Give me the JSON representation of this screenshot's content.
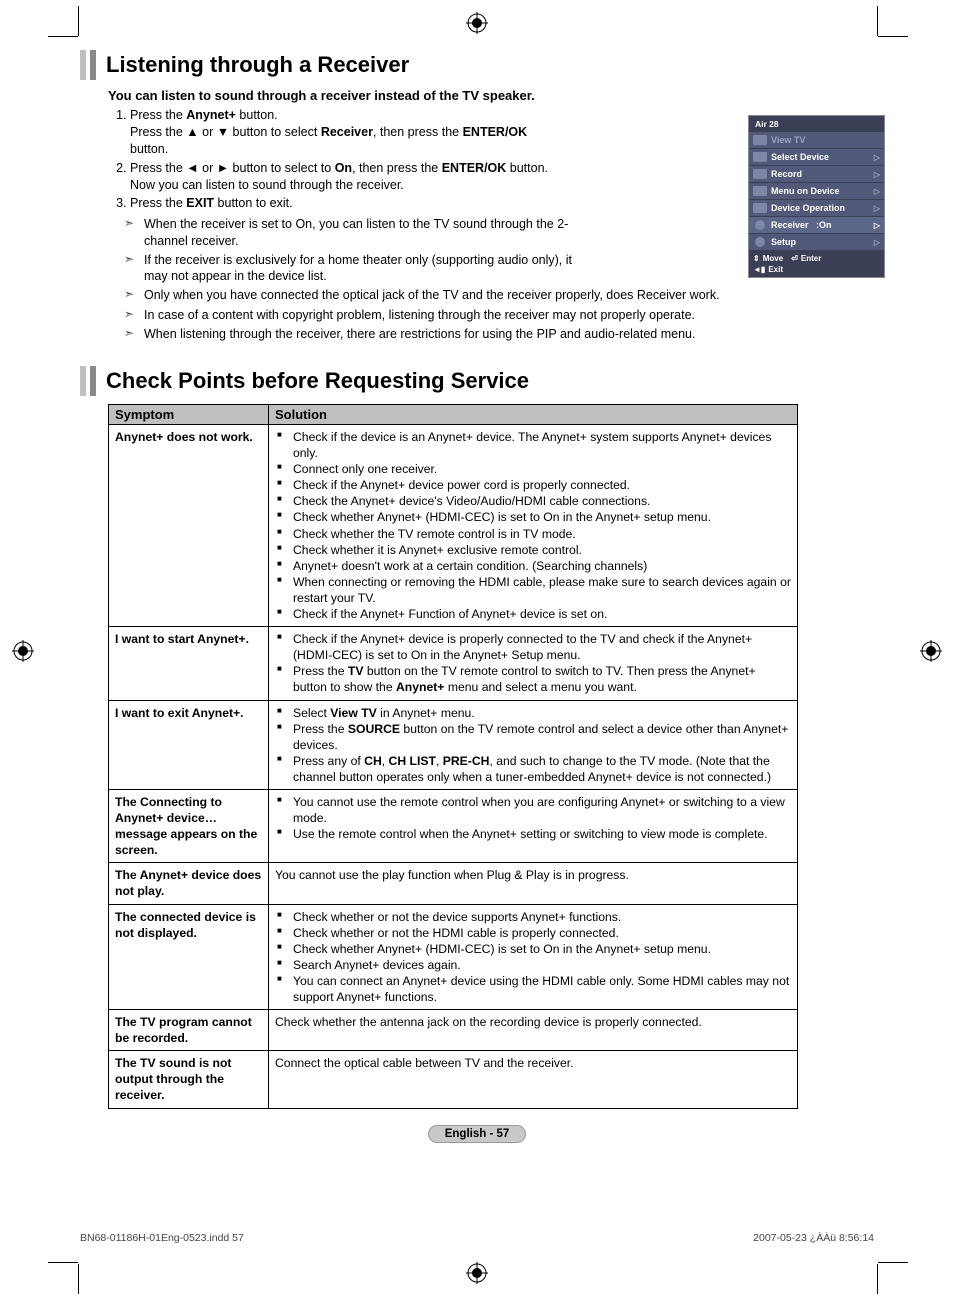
{
  "section1": {
    "title": "Listening through a Receiver",
    "subhead": "You can listen to sound through a receiver instead of the TV speaker.",
    "steps": [
      {
        "num": "1.",
        "html": "Press the <strong>Anynet+</strong> button.<br>Press the ▲ or ▼ button to select <strong>Receiver</strong>, then press the <strong>ENTER/OK</strong> button."
      },
      {
        "num": "2.",
        "html": "Press the ◄ or ► button to select to <strong>On</strong>, then press the <strong>ENTER/OK</strong> button.<br>Now you can listen to sound through the receiver."
      },
      {
        "num": "3.",
        "html": "Press the <strong>EXIT</strong> button to exit."
      }
    ],
    "notes": [
      "When the receiver is set to On, you can listen to the TV sound through the 2-channel receiver.",
      "If the receiver is exclusively for a home theater only (supporting audio only), it may not appear in the device list.",
      "Only when you have connected the optical jack of the TV and the receiver properly, does Receiver work.",
      "In case of a content with copyright problem, listening through the receiver may not properly operate.",
      "When listening through the receiver, there are restrictions for using the PIP and audio-related menu."
    ]
  },
  "osd": {
    "channel": "Air 28",
    "items": [
      {
        "label": "View TV",
        "dimmed": true,
        "arrow": false
      },
      {
        "label": "Select Device",
        "dimmed": false,
        "arrow": true
      },
      {
        "label": "Record",
        "dimmed": false,
        "arrow": true
      },
      {
        "label": "Menu on Device",
        "dimmed": false,
        "arrow": true
      },
      {
        "label": "Device Operation",
        "dimmed": false,
        "arrow": true
      },
      {
        "label": "Receiver",
        "value": ":On",
        "selected": true,
        "arrow": true,
        "round_icon": true
      },
      {
        "label": "Setup",
        "dimmed": false,
        "arrow": true,
        "round_icon": true
      }
    ],
    "footer": {
      "move": "Move",
      "enter": "Enter",
      "exit": "Exit"
    }
  },
  "section2": {
    "title": "Check Points before Requesting Service",
    "table_head": [
      "Symptom",
      "Solution"
    ],
    "rows": [
      {
        "symptom": "Anynet+ does not work.",
        "solution_list": [
          "Check if the device is an Anynet+ device. The Anynet+ system supports Anynet+ devices only.",
          "Connect only one receiver.",
          "Check if the Anynet+ device power cord is properly connected.",
          "Check the Anynet+ device's Video/Audio/HDMI cable connections.",
          "Check whether Anynet+ (HDMI-CEC) is set to On in the Anynet+ setup menu.",
          "Check whether the TV remote control is in TV mode.",
          "Check whether it is Anynet+ exclusive remote control.",
          "Anynet+ doesn't work at a certain condition. (Searching channels)",
          "When connecting or removing the HDMI cable, please make sure to search devices again or restart your TV.",
          "Check if the Anynet+ Function of Anynet+ device is set on."
        ]
      },
      {
        "symptom": "I want to start Anynet+.",
        "solution_html": [
          "Check if the Anynet+ device is properly connected to the TV and check if the Anynet+ (HDMI-CEC) is set to On in the Anynet+ Setup menu.",
          "Press the <strong>TV</strong> button on the TV remote control to switch to TV. Then press the Anynet+ button to show the <strong>Anynet+</strong> menu and select a menu you want."
        ],
        "is_html": true
      },
      {
        "symptom": "I want to exit Anynet+.",
        "solution_html": [
          "Select <strong>View TV</strong> in Anynet+ menu.",
          "Press the <strong>SOURCE</strong> button on the TV remote control and select a device other than Anynet+ devices.",
          "Press any of <strong>CH</strong>, <strong>CH LIST</strong>, <strong>PRE-CH</strong>, and such to change to the TV mode. (Note that the channel button operates only when a tuner-embedded Anynet+ device is not connected.)"
        ],
        "is_html": true
      },
      {
        "symptom": "The Connecting to Anynet+ device… message appears on the screen.",
        "solution_list": [
          "You cannot use the remote control when you are configuring Anynet+ or switching to a view mode.",
          "Use the remote control when the Anynet+ setting or switching to view mode is complete."
        ]
      },
      {
        "symptom": "The Anynet+ device does not play.",
        "solution_text": "You cannot use the play function when Plug & Play is in progress."
      },
      {
        "symptom": "The connected device is not displayed.",
        "solution_list": [
          "Check whether or not the device supports Anynet+ functions.",
          "Check whether or not the HDMI cable is properly connected.",
          "Check whether Anynet+ (HDMI-CEC) is set to On in the Anynet+ setup menu.",
          "Search Anynet+ devices again.",
          "You can connect an Anynet+ device using the HDMI cable only. Some HDMI cables may not support Anynet+ functions."
        ]
      },
      {
        "symptom": "The TV program cannot be recorded.",
        "solution_text": "Check whether the antenna jack on the recording device is properly connected."
      },
      {
        "symptom": "The TV sound is not output through the receiver.",
        "solution_text": "Connect the optical cable between TV and the receiver."
      }
    ]
  },
  "footer": {
    "page_badge": "English - 57",
    "doc_left": "BN68-01186H-01Eng-0523.indd   57",
    "doc_right": "2007-05-23   ¿ÀÀü 8:56:14"
  }
}
